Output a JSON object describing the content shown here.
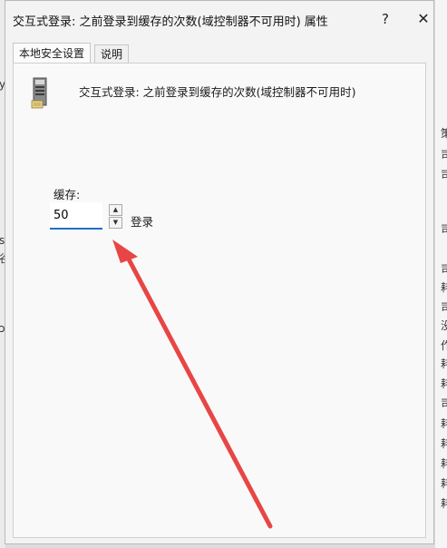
{
  "dialog": {
    "title": "交互式登录: 之前登录到缓存的次数(域控制器不可用时) 属性",
    "help_label": "?",
    "close_label": "✕"
  },
  "tabs": [
    {
      "label": "本地安全设置",
      "active": true
    },
    {
      "label": "说明",
      "active": false
    }
  ],
  "policy": {
    "name": "交互式登录: 之前登录到缓存的次数(域控制器不可用时)",
    "icon": "server-icon"
  },
  "setting": {
    "label": "缓存:",
    "value": "50",
    "unit": "登录"
  },
  "colors": {
    "accent": "#1f6fc5",
    "arrow": "#e84545"
  }
}
